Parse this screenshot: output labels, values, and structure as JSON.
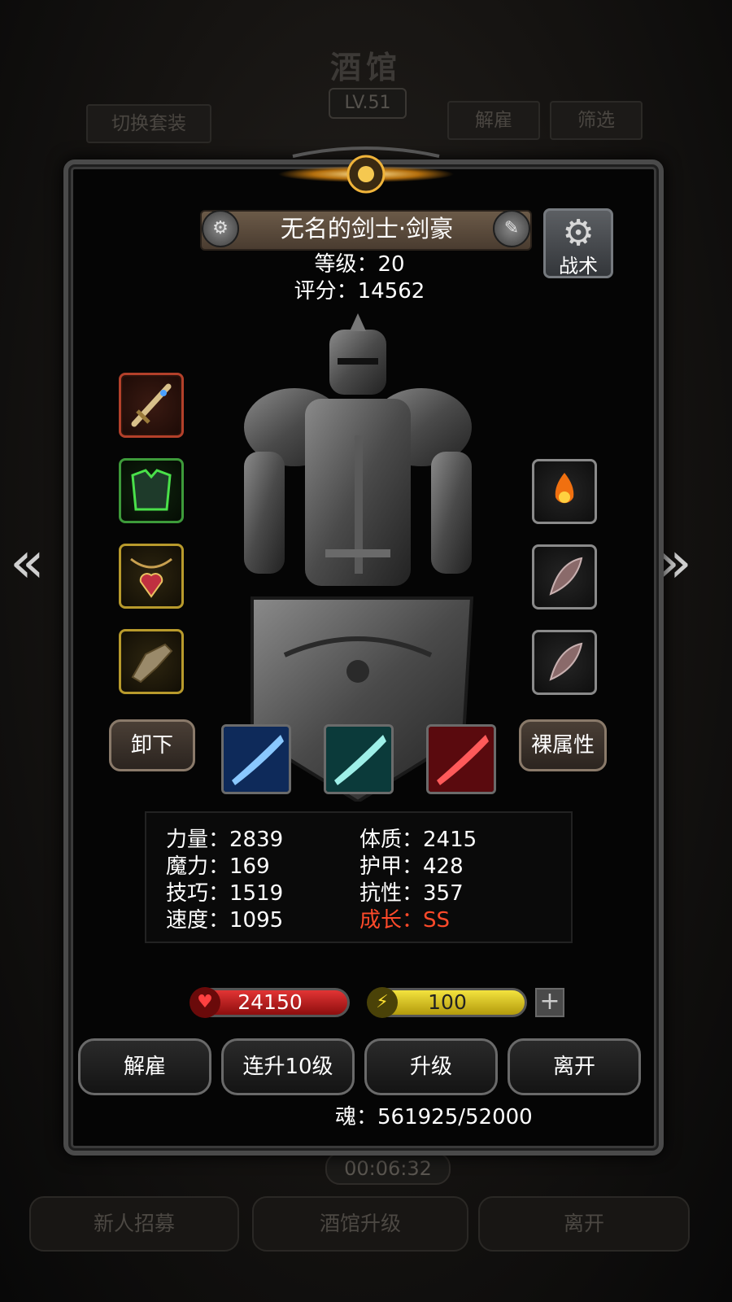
{
  "background": {
    "title": "酒馆",
    "level_badge": "LV.51",
    "switch_outfit": "切换套装",
    "dismiss": "解雇",
    "filter": "筛选",
    "timer": "00:06:32",
    "bottom_buttons": [
      "新人招募",
      "酒馆升级",
      "离开"
    ],
    "left_arrow": "«",
    "right_arrow": "»"
  },
  "hero": {
    "name": "无名的剑士·剑豪",
    "level_line": "等级：20",
    "score_line": "评分：14562",
    "tactic_label": "战术",
    "unequip_label": "卸下",
    "naked_attr_label": "裸属性"
  },
  "equipment_left": [
    {
      "icon": "sword-icon",
      "rarity": "red"
    },
    {
      "icon": "armor-icon",
      "rarity": "green"
    },
    {
      "icon": "necklace-icon",
      "rarity": "gold"
    },
    {
      "icon": "gauntlet-icon",
      "rarity": "gold"
    }
  ],
  "equipment_right": [
    {
      "icon": "fire-rune-icon",
      "rarity": "grey"
    },
    {
      "icon": "feather-icon",
      "rarity": "grey"
    },
    {
      "icon": "feather-icon",
      "rarity": "grey"
    }
  ],
  "skills": [
    {
      "icon": "blue-slash-icon",
      "color": "#3f7bd6"
    },
    {
      "icon": "cyan-slash-icon",
      "color": "#34b6b6"
    },
    {
      "icon": "red-slash-icon",
      "color": "#c4202a"
    }
  ],
  "stats": {
    "left": [
      "力量：2839",
      "魔力：169",
      "技巧：1519",
      "速度：1095"
    ],
    "right": [
      "体质：2415",
      "护甲：428",
      "抗性：357",
      "成长：SS"
    ]
  },
  "bars": {
    "hp": "24150",
    "energy": "100"
  },
  "actions": {
    "dismiss": "解雇",
    "level_up_10": "连升10级",
    "level_up": "升级",
    "leave": "离开"
  },
  "soul_line": "魂：561925/52000",
  "colors": {
    "growth_highlight": "#ff4a2a",
    "hp": "#d42a2a",
    "energy": "#e8d42a"
  }
}
